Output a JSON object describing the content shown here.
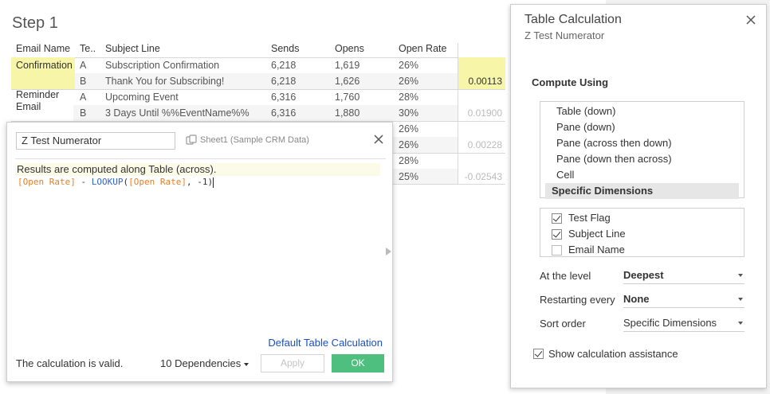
{
  "worksheet": {
    "title": "Step 1",
    "columns": [
      "Email Name",
      "Te..",
      "Subject Line",
      "Sends",
      "Opens",
      "Open Rate"
    ],
    "rows": [
      {
        "email": "Confirmation",
        "flag": "A",
        "subject": "Subscription Confirmation",
        "sends": "6,218",
        "opens": "1,619",
        "rate": "26%",
        "calc": ""
      },
      {
        "email": "",
        "flag": "B",
        "subject": "Thank You for Subscribing!",
        "sends": "6,218",
        "opens": "1,626",
        "rate": "26%",
        "calc": "0.00113"
      },
      {
        "email": "Reminder Email",
        "flag": "A",
        "subject": "Upcoming Event",
        "sends": "6,316",
        "opens": "1,760",
        "rate": "28%",
        "calc": ""
      },
      {
        "email": "",
        "flag": "B",
        "subject": "3 Days Until %%EventName%%",
        "sends": "6,316",
        "opens": "1,880",
        "rate": "30%",
        "calc": "0.01900"
      },
      {
        "email": "",
        "flag": "",
        "subject": "",
        "sends": "",
        "opens": "",
        "rate": "26%",
        "calc": ""
      },
      {
        "email": "",
        "flag": "",
        "subject": "",
        "sends": "",
        "opens": "",
        "rate": "26%",
        "calc": "0.00228"
      },
      {
        "email": "",
        "flag": "",
        "subject": "",
        "sends": "",
        "opens": "",
        "rate": "28%",
        "calc": ""
      },
      {
        "email": "",
        "flag": "",
        "subject": "",
        "sends": "",
        "opens": "",
        "rate": "25%",
        "calc": "-0.02543"
      }
    ],
    "reminder_line1": "Reminder",
    "reminder_line2": "Email"
  },
  "editor": {
    "calc_name": "Z Test Numerator",
    "sheet_ref": "Sheet1 (Sample CRM Data)",
    "note": "Results are computed along Table (across).",
    "formula_field1": "[Open Rate]",
    "formula_minus": " - ",
    "formula_func": "LOOKUP",
    "formula_open": "(",
    "formula_field2": "[Open Rate]",
    "formula_rest": ", -1)",
    "default_link": "Default Table Calculation",
    "status": "The calculation is valid.",
    "dependencies": "10 Dependencies",
    "apply_label": "Apply",
    "ok_label": "OK"
  },
  "panel": {
    "title": "Table Calculation",
    "subtitle": "Z Test Numerator",
    "section": "Compute Using",
    "compute_options": [
      "Table (down)",
      "Pane (down)",
      "Pane (across then down)",
      "Pane (down then across)",
      "Cell",
      "Specific Dimensions"
    ],
    "selected_index": 5,
    "dimensions": [
      {
        "label": "Test Flag",
        "checked": true
      },
      {
        "label": "Subject Line",
        "checked": true
      },
      {
        "label": "Email Name",
        "checked": false
      }
    ],
    "at_level_label": "At the level",
    "at_level_value": "Deepest",
    "restart_label": "Restarting every",
    "restart_value": "None",
    "sort_label": "Sort order",
    "sort_value": "Specific Dimensions",
    "assist_label": "Show calculation assistance"
  },
  "colors": {
    "highlight": "#f6f5a8",
    "ok_button": "#4fbf7f",
    "link": "#1a4fc0",
    "formula_field": "#e2812a",
    "formula_function": "#3366cc"
  }
}
